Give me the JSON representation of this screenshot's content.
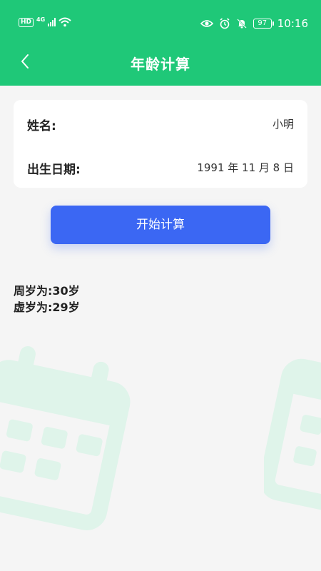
{
  "status_bar": {
    "hd_badge": "HD",
    "network": "4G",
    "battery": "97",
    "time": "10:16"
  },
  "nav": {
    "title": "年龄计算",
    "back_icon": "chevron-left-icon"
  },
  "form": {
    "name_label": "姓名:",
    "name_value": "小明",
    "birth_label": "出生日期:",
    "birth_value": "1991 年 11 月 8 日"
  },
  "action": {
    "calculate_label": "开始计算"
  },
  "results": {
    "full_age": "周岁为:30岁",
    "nominal_age": "虚岁为:29岁"
  },
  "colors": {
    "header": "#1fc878",
    "button": "#3b67f3",
    "background": "#f5f5f5",
    "decoration": "#dff4ea"
  }
}
